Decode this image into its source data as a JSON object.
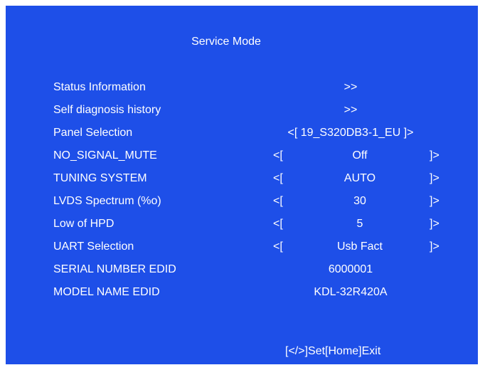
{
  "title": "Service Mode",
  "rows": [
    {
      "label": "Status Information",
      "value": ">>"
    },
    {
      "label": "Self diagnosis history",
      "value": ">>"
    },
    {
      "label": "Panel Selection",
      "value": "<[ 19_S320DB3-1_EU ]>"
    },
    {
      "label": "NO_SIGNAL_MUTE",
      "left": "<[",
      "value": "Off",
      "right": "]>"
    },
    {
      "label": "TUNING SYSTEM",
      "left": "<[",
      "value": "AUTO",
      "right": "]>"
    },
    {
      "label": "LVDS Spectrum (%o)",
      "left": "<[",
      "value": "30",
      "right": "]>"
    },
    {
      "label": "Low of HPD",
      "left": "<[",
      "value": "5",
      "right": "]>"
    },
    {
      "label": "UART Selection",
      "left": "<[",
      "value": "Usb Fact",
      "right": "]>"
    },
    {
      "label": "SERIAL NUMBER EDID",
      "value": "6000001"
    },
    {
      "label": "MODEL NAME EDID",
      "value": "KDL-32R420A"
    }
  ],
  "footer": "[</>]Set[Home]Exit",
  "colors": {
    "background": "#1e4fe8",
    "text": "#ffffff"
  }
}
